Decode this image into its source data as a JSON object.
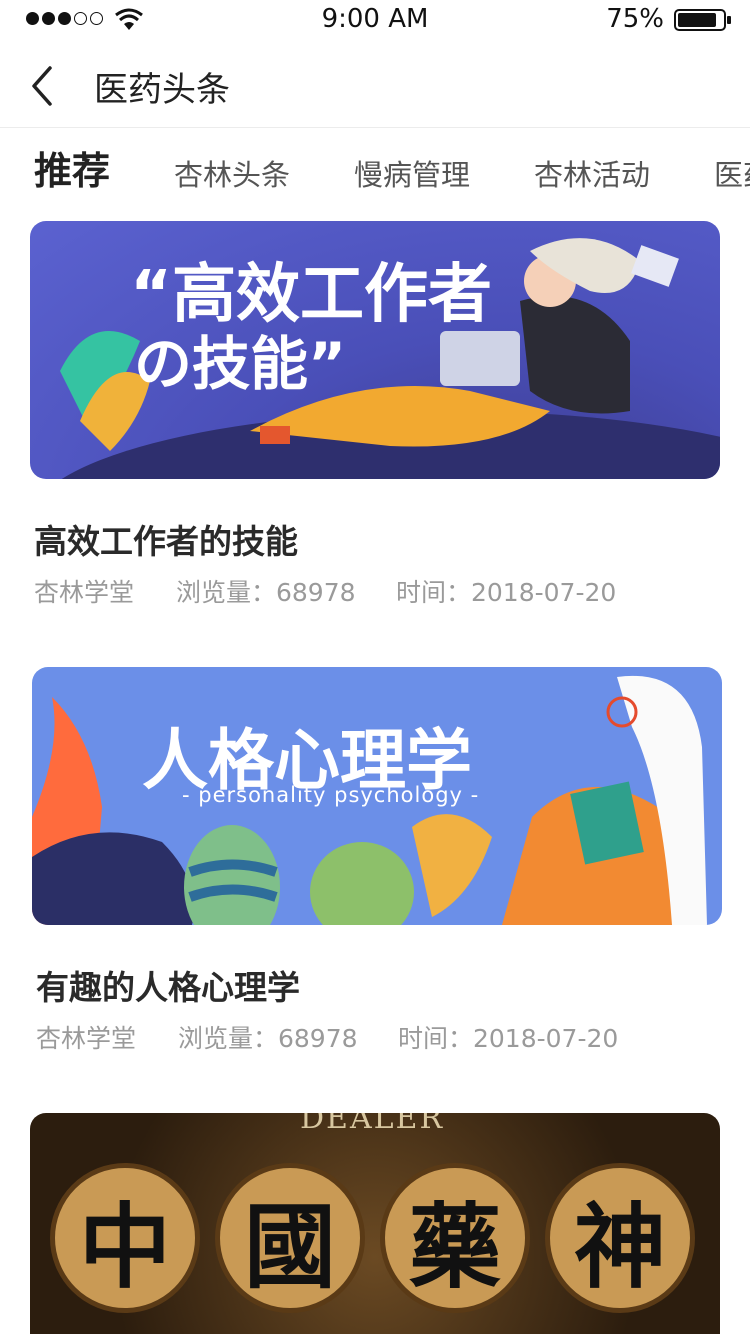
{
  "status_bar": {
    "time": "9:00 AM",
    "battery_percent": "75%"
  },
  "nav": {
    "title": "医药头条",
    "back_icon": "chevron-left-icon"
  },
  "tabs": [
    {
      "label": "推荐",
      "active": true
    },
    {
      "label": "杏林头条",
      "active": false
    },
    {
      "label": "慢病管理",
      "active": false
    },
    {
      "label": "杏林活动",
      "active": false
    },
    {
      "label": "医药",
      "active": false
    }
  ],
  "articles": [
    {
      "title": "高效工作者的技能",
      "source": "杏林学堂",
      "views": "浏览量：68978",
      "time": "时间：2018-07-20",
      "banner": {
        "line1": "“高效工作者",
        "line2": "の技能”"
      }
    },
    {
      "title": "有趣的人格心理学",
      "source": "杏林学堂",
      "views": "浏览量：68978",
      "time": "时间：2018-07-20",
      "banner": {
        "line1": "人格心理学",
        "line2": "- personality psychology -"
      }
    },
    {
      "title": "",
      "banner": {
        "chars": [
          "中",
          "國",
          "藥",
          "神"
        ],
        "top": "DEALER"
      }
    }
  ]
}
